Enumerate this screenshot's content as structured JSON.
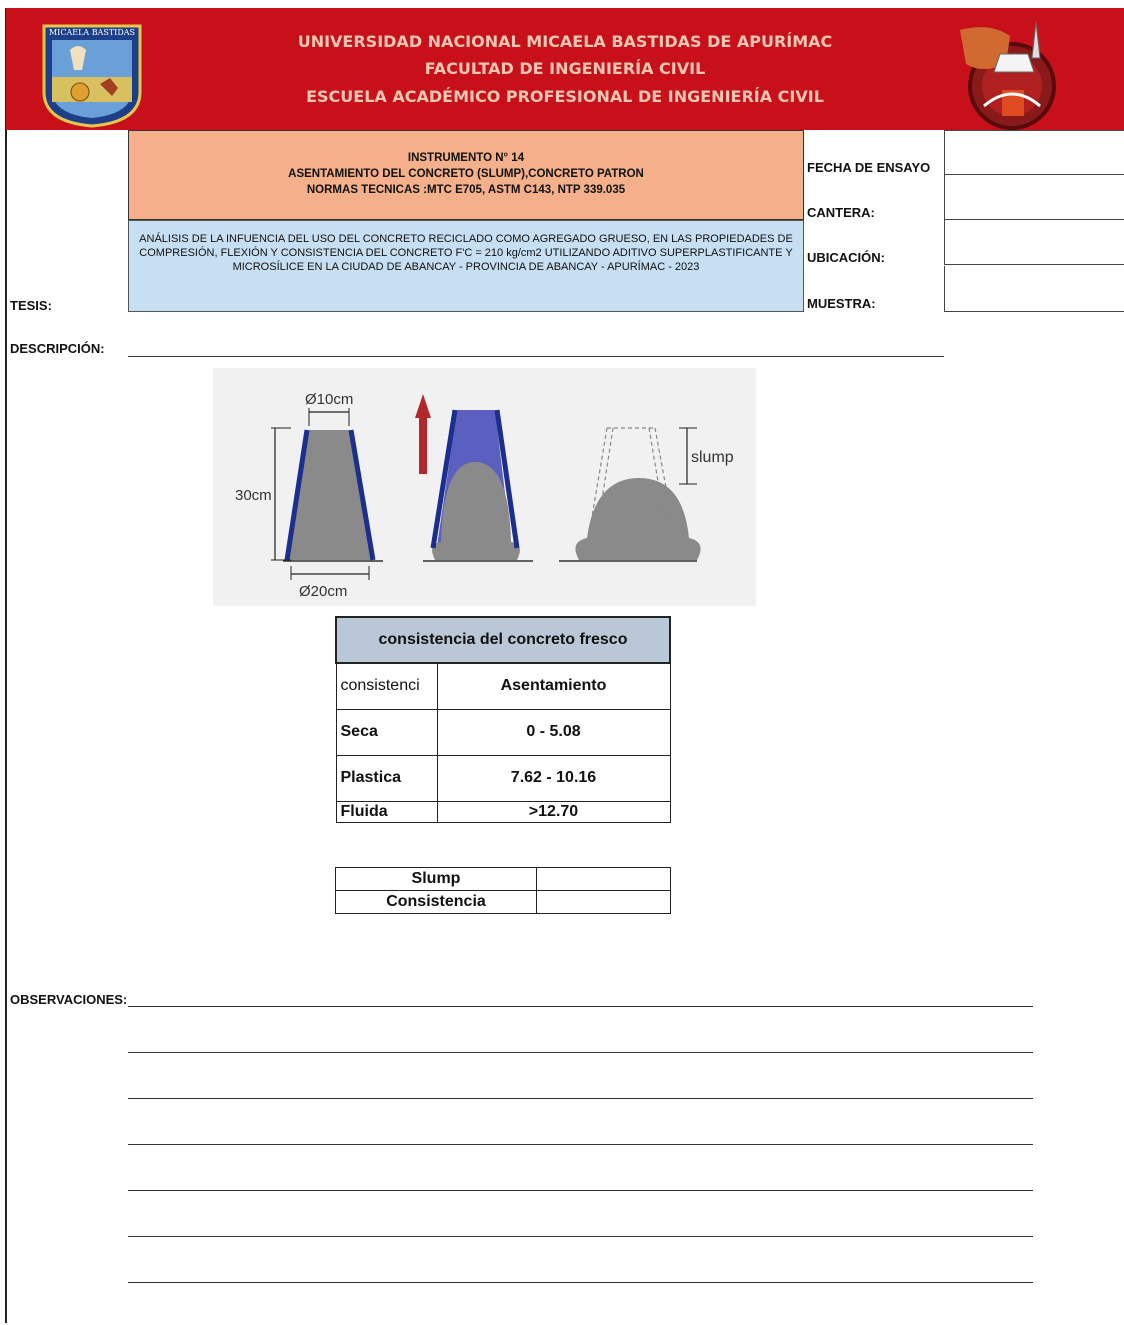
{
  "header": {
    "line1": "UNIVERSIDAD NACIONAL MICAELA BASTIDAS DE APURÍMAC",
    "line2": "FACULTAD  DE INGENIERÍA CIVIL",
    "line3": "ESCUELA ACADÉMICO PROFESIONAL DE INGENIERÍA CIVIL",
    "logo_left_text": "MICAELA BASTIDAS",
    "colors": {
      "header_bg": "#c8101a",
      "header_text": "#f3c7b3",
      "title_box": "#f3b08a",
      "thesis_box": "#c7dff2",
      "table_header": "#b9c7d6"
    }
  },
  "instrument": {
    "line1": "INSTRUMENTO N° 14",
    "line2": "ASENTAMIENTO DEL CONCRETO (SLUMP),CONCRETO PATRON",
    "line3": "NORMAS TECNICAS :MTC E705, ASTM C143, NTP 339.035"
  },
  "thesis_text": "ANÁLISIS DE LA INFUENCIA DEL USO DEL CONCRETO RECICLADO COMO AGREGADO GRUESO, EN LAS PROPIEDADES DE COMPRESIÓN, FLEXIÓN Y CONSISTENCIA DEL CONCRETO F'C = 210 kg/cm2 UTILIZANDO ADITIVO SUPERPLASTIFICANTE Y MICROSÍLICE EN LA CIUDAD DE ABANCAY - PROVINCIA DE ABANCAY - APURÍMAC - 2023",
  "labels": {
    "fecha": "FECHA DE ENSAYO",
    "cantera": "CANTERA:",
    "ubicacion": "UBICACIÓN:",
    "muestra": "MUESTRA:",
    "tesis": "TESIS:",
    "descripcion": "DESCRIPCIÓN:",
    "observaciones": "OBSERVACIONES:"
  },
  "diagram": {
    "top_diameter": "Ø10cm",
    "height": "30cm",
    "bottom_diameter": "Ø20cm",
    "slump": "slump"
  },
  "consistency_table": {
    "title": "consistencia del concreto fresco",
    "col1": "consistenci",
    "col2": "Asentamiento",
    "rows": [
      {
        "name": "Seca",
        "value": "0 - 5.08"
      },
      {
        "name": "Plastica",
        "value": "7.62 - 10.16"
      },
      {
        "name": "Fluida",
        "value": ">12.70"
      }
    ]
  },
  "result_table": {
    "slump": "Slump",
    "consistencia": "Consistencia"
  }
}
